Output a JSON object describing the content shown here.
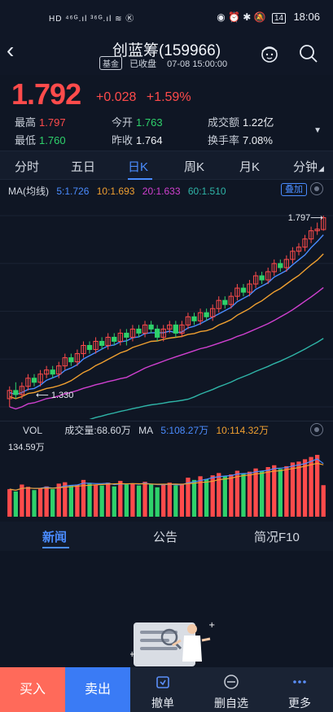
{
  "statusbar": {
    "left": "HD ⁴⁶ᴳ.ıl ³⁶ᴳ.ıl ≋ Ⓚ",
    "right_icons": "◉ ⏰ ✱ 🔕",
    "battery": "14",
    "time": "18:06"
  },
  "header": {
    "title": "创蓝筹(159966)",
    "tag": "基金",
    "status": "已收盘",
    "datetime": "07-08 15:00:00",
    "icons": [
      "back-icon",
      "avatar-icon",
      "search-icon"
    ]
  },
  "quote": {
    "price": "1.792",
    "change": "+0.028",
    "change_pct": "+1.59%",
    "high_label": "最高",
    "high": "1.797",
    "low_label": "最低",
    "low": "1.760",
    "open_label": "今开",
    "open": "1.763",
    "prev_label": "昨收",
    "prev": "1.764",
    "turnover_label": "成交额",
    "turnover": "1.22亿",
    "rate_label": "换手率",
    "rate": "7.08%"
  },
  "tabs": [
    "分时",
    "五日",
    "日K",
    "周K",
    "月K",
    "分钟"
  ],
  "active_tab": "日K",
  "ma": {
    "label": "MA(均线)",
    "ma5": "5:1.726",
    "ma10": "10:1.693",
    "ma20": "20:1.633",
    "ma60": "60:1.510",
    "add_button": "叠加",
    "high_mark": "1.797",
    "low_mark": "1.330"
  },
  "vol": {
    "label": "VOL",
    "volume": "成交量:68.60万",
    "ma_label": "MA",
    "ma5": "5:108.27万",
    "ma10": "10:114.32万",
    "max": "134.59万"
  },
  "news_tabs": [
    "新闻",
    "公告",
    "简况F10"
  ],
  "bottombar": {
    "buy": "买入",
    "sell": "卖出",
    "cancel": "撤单",
    "remove": "删自选",
    "more": "更多"
  },
  "colors": {
    "up": "#ff4b4b",
    "down": "#2ed16b",
    "ma5": "#4a8cff",
    "ma10": "#f0a030",
    "ma20": "#d040d0",
    "ma60": "#2fb5a8",
    "accent": "#4a8cff"
  },
  "chart_data": {
    "type": "candlestick",
    "price_range": [
      1.33,
      1.797
    ],
    "candles": [
      [
        1.35,
        1.37,
        1.33,
        1.38
      ],
      [
        1.37,
        1.36,
        1.35,
        1.39
      ],
      [
        1.36,
        1.38,
        1.35,
        1.39
      ],
      [
        1.38,
        1.4,
        1.37,
        1.41
      ],
      [
        1.4,
        1.39,
        1.38,
        1.41
      ],
      [
        1.39,
        1.41,
        1.38,
        1.42
      ],
      [
        1.41,
        1.42,
        1.4,
        1.43
      ],
      [
        1.42,
        1.41,
        1.4,
        1.43
      ],
      [
        1.41,
        1.43,
        1.4,
        1.44
      ],
      [
        1.43,
        1.45,
        1.42,
        1.46
      ],
      [
        1.45,
        1.44,
        1.43,
        1.46
      ],
      [
        1.44,
        1.46,
        1.43,
        1.47
      ],
      [
        1.46,
        1.48,
        1.45,
        1.49
      ],
      [
        1.48,
        1.47,
        1.46,
        1.49
      ],
      [
        1.47,
        1.49,
        1.46,
        1.5
      ],
      [
        1.49,
        1.48,
        1.47,
        1.5
      ],
      [
        1.48,
        1.5,
        1.47,
        1.51
      ],
      [
        1.5,
        1.49,
        1.48,
        1.51
      ],
      [
        1.49,
        1.51,
        1.48,
        1.52
      ],
      [
        1.51,
        1.5,
        1.48,
        1.52
      ],
      [
        1.5,
        1.52,
        1.49,
        1.53
      ],
      [
        1.52,
        1.51,
        1.5,
        1.53
      ],
      [
        1.51,
        1.53,
        1.5,
        1.54
      ],
      [
        1.53,
        1.52,
        1.51,
        1.54
      ],
      [
        1.52,
        1.5,
        1.49,
        1.53
      ],
      [
        1.5,
        1.52,
        1.49,
        1.53
      ],
      [
        1.52,
        1.53,
        1.51,
        1.54
      ],
      [
        1.53,
        1.51,
        1.5,
        1.54
      ],
      [
        1.51,
        1.53,
        1.5,
        1.54
      ],
      [
        1.53,
        1.55,
        1.52,
        1.56
      ],
      [
        1.55,
        1.54,
        1.53,
        1.56
      ],
      [
        1.54,
        1.56,
        1.53,
        1.57
      ],
      [
        1.56,
        1.55,
        1.54,
        1.57
      ],
      [
        1.55,
        1.57,
        1.54,
        1.58
      ],
      [
        1.57,
        1.59,
        1.56,
        1.6
      ],
      [
        1.59,
        1.58,
        1.57,
        1.6
      ],
      [
        1.58,
        1.6,
        1.57,
        1.61
      ],
      [
        1.6,
        1.62,
        1.59,
        1.63
      ],
      [
        1.62,
        1.61,
        1.6,
        1.63
      ],
      [
        1.61,
        1.63,
        1.6,
        1.64
      ],
      [
        1.63,
        1.65,
        1.62,
        1.66
      ],
      [
        1.65,
        1.64,
        1.63,
        1.66
      ],
      [
        1.64,
        1.66,
        1.63,
        1.67
      ],
      [
        1.66,
        1.68,
        1.65,
        1.69
      ],
      [
        1.68,
        1.67,
        1.66,
        1.69
      ],
      [
        1.67,
        1.69,
        1.66,
        1.7
      ],
      [
        1.69,
        1.71,
        1.68,
        1.72
      ],
      [
        1.71,
        1.72,
        1.7,
        1.73
      ],
      [
        1.72,
        1.74,
        1.71,
        1.75
      ],
      [
        1.74,
        1.76,
        1.73,
        1.77
      ],
      [
        1.76,
        1.764,
        1.75,
        1.78
      ],
      [
        1.763,
        1.792,
        1.76,
        1.797
      ]
    ],
    "volumes_wan": [
      60,
      55,
      70,
      65,
      58,
      62,
      66,
      60,
      72,
      75,
      68,
      70,
      80,
      72,
      70,
      68,
      74,
      66,
      78,
      70,
      72,
      68,
      76,
      70,
      64,
      70,
      74,
      68,
      72,
      85,
      80,
      88,
      82,
      90,
      95,
      88,
      92,
      100,
      94,
      98,
      105,
      100,
      108,
      112,
      104,
      110,
      118,
      120,
      125,
      130,
      134.59,
      68.6
    ]
  }
}
